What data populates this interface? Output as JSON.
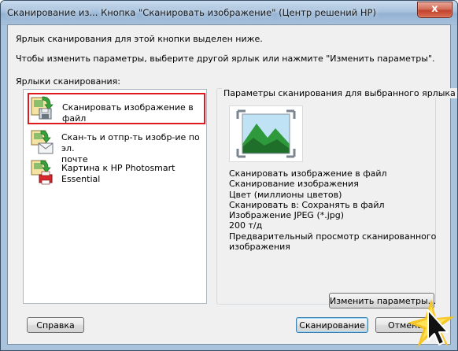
{
  "window": {
    "title": "Сканирование из... Кнопка \"Сканировать изображение\" (Центр решений HP)",
    "close_glyph": "x"
  },
  "description": {
    "line1": "Ярлык сканирования для этой кнопки выделен ниже.",
    "line2": "Чтобы изменить параметры, выберите другой ярлык или нажмите \"Изменить параметры\"."
  },
  "shortcuts": {
    "label": "Ярлыки сканирования:",
    "items": [
      {
        "line1": "Сканировать изображение в файл",
        "line2": "",
        "icon": "scan-to-file-icon",
        "selected": true
      },
      {
        "line1": "Скан-ть и отпр-ть изобр-ие по эл.",
        "line2": "почте",
        "icon": "scan-to-email-icon",
        "selected": false
      },
      {
        "line1": "Картина к HP Photosmart Essential",
        "line2": "",
        "icon": "scan-to-photosmart-icon",
        "selected": false
      }
    ]
  },
  "settings": {
    "title": "Параметры сканирования для выбранного ярлыка",
    "details": [
      "Сканировать изображение в файл",
      "Сканирование изображения",
      "Цвет (миллионы цветов)",
      "Сканировать в: Сохранять в файл",
      "Изображение JPEG (*.jpg)",
      "200 т/д",
      "Предварительный просмотр сканированного",
      "изображения"
    ],
    "change_button": "Изменить параметры..."
  },
  "footer": {
    "help": "Справка",
    "scan": "Сканирование",
    "cancel": "Отмена"
  },
  "colors": {
    "selection_border": "#e0191f",
    "window_frame": "#a9c3dd",
    "close_button": "#c3422c",
    "preview_green": "#2f9a3b",
    "preview_sky": "#bfe3f4"
  }
}
